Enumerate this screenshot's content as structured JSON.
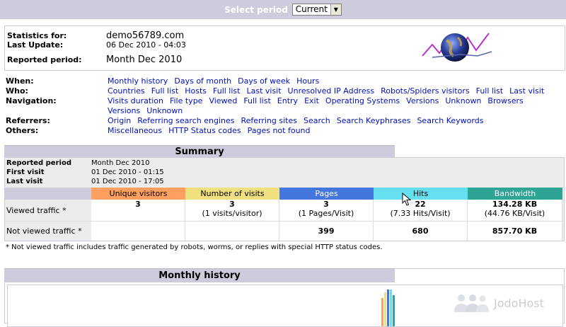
{
  "period": {
    "label": "Select period",
    "selected": "Current"
  },
  "info": {
    "stats_for_label": "Statistics for:",
    "stats_for_value": "demo56789.com",
    "last_update_label": "Last Update:",
    "last_update_value": "06 Dec 2010 - 04:03",
    "reported_label": "Reported period:",
    "reported_value": "Month Dec 2010"
  },
  "nav": [
    {
      "label": "When:",
      "links": [
        "Monthly history",
        "Days of month",
        "Days of week",
        "Hours"
      ]
    },
    {
      "label": "Who:",
      "links": [
        "Countries",
        "Full list",
        "Hosts",
        "Full list",
        "Last visit",
        "Unresolved IP Address",
        "Robots/Spiders visitors",
        "Full list",
        "Last visit"
      ]
    },
    {
      "label": "Navigation:",
      "links": [
        "Visits duration",
        "File type",
        "Viewed",
        "Full list",
        "Entry",
        "Exit",
        "Operating Systems",
        "Versions",
        "Unknown",
        "Browsers",
        "Versions",
        "Unknown"
      ]
    },
    {
      "label": "Referrers:",
      "links": [
        "Origin",
        "Referring search engines",
        "Referring sites",
        "Search",
        "Search Keyphrases",
        "Search Keywords"
      ]
    },
    {
      "label": "Others:",
      "links": [
        "Miscellaneous",
        "HTTP Status codes",
        "Pages not found"
      ]
    }
  ],
  "summary": {
    "title": "Summary",
    "reported_label": "Reported period",
    "reported_value": "Month Dec 2010",
    "first_label": "First visit",
    "first_value": "01 Dec 2010 - 01:15",
    "last_label": "Last visit",
    "last_value": "01 Dec 2010 - 17:05",
    "headers": [
      {
        "label": "Unique visitors",
        "color": "#ffa060"
      },
      {
        "label": "Number of visits",
        "color": "#f0e080"
      },
      {
        "label": "Pages",
        "color": "#4477dd"
      },
      {
        "label": "Hits",
        "color": "#66e0f0"
      },
      {
        "label": "Bandwidth",
        "color": "#2ea495"
      }
    ],
    "viewed_label": "Viewed traffic *",
    "viewed": [
      {
        "main": "3",
        "sub": ""
      },
      {
        "main": "3",
        "sub": "(1 visits/visitor)"
      },
      {
        "main": "3",
        "sub": "(1 Pages/Visit)"
      },
      {
        "main": "22",
        "sub": "(7.33 Hits/Visit)"
      },
      {
        "main": "134.28 KB",
        "sub": "(44.76 KB/Visit)"
      }
    ],
    "not_viewed_label": "Not viewed traffic *",
    "not_viewed": [
      "",
      "",
      "399",
      "680",
      "857.70 KB"
    ],
    "note": "* Not viewed traffic includes traffic generated by robots, worms, or replies with special HTTP status codes."
  },
  "monthly": {
    "title": "Monthly history"
  },
  "watermark": "JodoHost"
}
